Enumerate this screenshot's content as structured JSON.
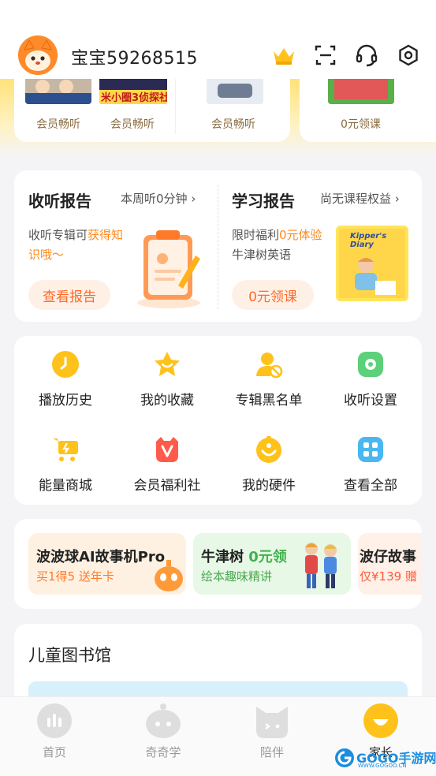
{
  "header": {
    "username": "宝宝59268515",
    "icons": [
      "crown-icon",
      "scan-icon",
      "headset-icon",
      "settings-icon"
    ]
  },
  "vip_strip": {
    "items": [
      {
        "label": "会员畅听",
        "badge": "米小圈3侦探社"
      },
      {
        "label": "会员畅听"
      },
      {
        "label": "会员畅听"
      },
      {
        "label": "0元领课"
      }
    ]
  },
  "reports": {
    "listen": {
      "title": "收听报告",
      "meta": "本周听0分钟",
      "desc_prefix": "收听专辑可",
      "desc_highlight1": "获得知",
      "desc_highlight2": "识哦～",
      "button": "查看报告"
    },
    "study": {
      "title": "学习报告",
      "meta": "尚无课程权益",
      "desc_prefix": "限时福利",
      "desc_highlight": "0元体验",
      "desc_line2": "牛津树英语",
      "button": "0元领课",
      "book_title": "Kipper's Diary"
    }
  },
  "menu": {
    "items": [
      {
        "label": "播放历史",
        "icon": "clock-icon"
      },
      {
        "label": "我的收藏",
        "icon": "star-icon"
      },
      {
        "label": "专辑黑名单",
        "icon": "block-user-icon"
      },
      {
        "label": "收听设置",
        "icon": "speaker-settings-icon"
      },
      {
        "label": "能量商城",
        "icon": "cart-icon"
      },
      {
        "label": "会员福利社",
        "icon": "vip-gift-icon"
      },
      {
        "label": "我的硬件",
        "icon": "device-icon"
      },
      {
        "label": "查看全部",
        "icon": "grid-icon"
      }
    ]
  },
  "promos": [
    {
      "title": "波波球AI故事机Pro",
      "subtitle": "买1得5 送年卡"
    },
    {
      "title_prefix": "牛津树 ",
      "title_highlight": "0元领",
      "subtitle": "绘本趣味精讲"
    },
    {
      "title": "波仔故事",
      "subtitle": "仅¥139 赠"
    }
  ],
  "library": {
    "title": "儿童图书馆"
  },
  "tabs": [
    {
      "label": "首页",
      "icon": "home-icon"
    },
    {
      "label": "奇奇学",
      "icon": "robot-icon"
    },
    {
      "label": "陪伴",
      "icon": "cat-icon"
    },
    {
      "label": "家长",
      "icon": "parent-icon"
    }
  ],
  "watermark": {
    "text": "GOGO手游网",
    "url_text": "WWW.GOGOO.CN"
  },
  "colors": {
    "accent": "#ff8a1c",
    "yellow": "#ffc21a",
    "pill_bg": "#fff0e6"
  }
}
